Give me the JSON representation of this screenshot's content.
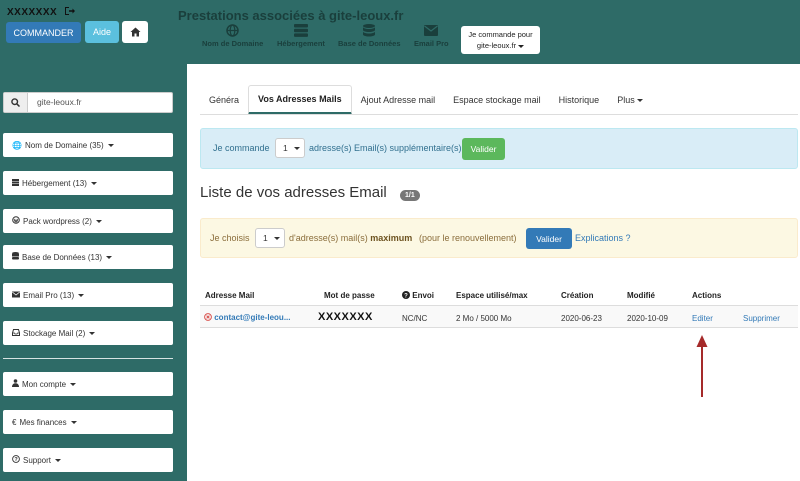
{
  "header": {
    "user_name": "XXXXXXX",
    "commander_label": "COMMANDER",
    "aide_label": "Aide",
    "title": "Prestations associées à gite-leoux.fr",
    "quick_links": [
      "Nom de Domaine",
      "Hébergement",
      "Base de Données",
      "Email Pro"
    ],
    "order_box_line1": "Je commande pour",
    "order_box_line2": "gite-leoux.fr"
  },
  "sidebar": {
    "search_value": "gite-leoux.fr",
    "menu": [
      {
        "icon": "globe-icon",
        "label": "Nom de Domaine (35)"
      },
      {
        "icon": "server-icon",
        "label": "Hébergement (13)"
      },
      {
        "icon": "wordpress-icon",
        "label": "Pack wordpress (2)"
      },
      {
        "icon": "database-icon",
        "label": "Base de Données (13)"
      },
      {
        "icon": "envelope-icon",
        "label": "Email Pro (13)"
      },
      {
        "icon": "inbox-icon",
        "label": "Stockage Mail (2)"
      }
    ],
    "account_menu": [
      {
        "icon": "user-icon",
        "label": "Mon compte"
      },
      {
        "icon": "euro-icon",
        "label": "Mes finances"
      },
      {
        "icon": "question-icon",
        "label": "Support"
      }
    ]
  },
  "tabs": [
    {
      "label": "Généra",
      "active": false
    },
    {
      "label": "Vos Adresses Mails",
      "active": true
    },
    {
      "label": "Ajout Adresse mail",
      "active": false
    },
    {
      "label": "Espace stockage mail",
      "active": false
    },
    {
      "label": "Historique",
      "active": false
    },
    {
      "label": "Plus",
      "active": false
    }
  ],
  "info_alert": {
    "prefix": "Je commande",
    "quantity": "1",
    "suffix": "adresse(s) Email(s) supplémentaire(s)",
    "button": "Valider"
  },
  "list": {
    "title": "Liste de vos adresses Email",
    "badge": "1/1"
  },
  "warn_alert": {
    "prefix": "Je choisis",
    "quantity": "1",
    "mid": "d'adresse(s) mail(s)",
    "bold": "maximum",
    "suffix": "(pour le renouvellement)",
    "button": "Valider",
    "link": "Explications ?"
  },
  "table": {
    "headers": [
      "Adresse Mail",
      "Mot de passe",
      "Envoi",
      "Espace utilisé/max",
      "Création",
      "Modifié",
      "Actions"
    ],
    "rows": [
      {
        "email": "contact@gite-leou...",
        "password": "XXXXXXX",
        "envoi": "NC/NC",
        "space": "2 Mo / 5000 Mo",
        "created": "2020-06-23",
        "modified": "2020-10-09",
        "edit": "Editer",
        "delete": "Supprimer"
      }
    ]
  },
  "colors": {
    "sidebar_bg": "#2e6b67",
    "primary": "#337ab7",
    "success": "#5cb85c",
    "info": "#5bc0de",
    "annotation_arrow": "#a52a2a"
  }
}
